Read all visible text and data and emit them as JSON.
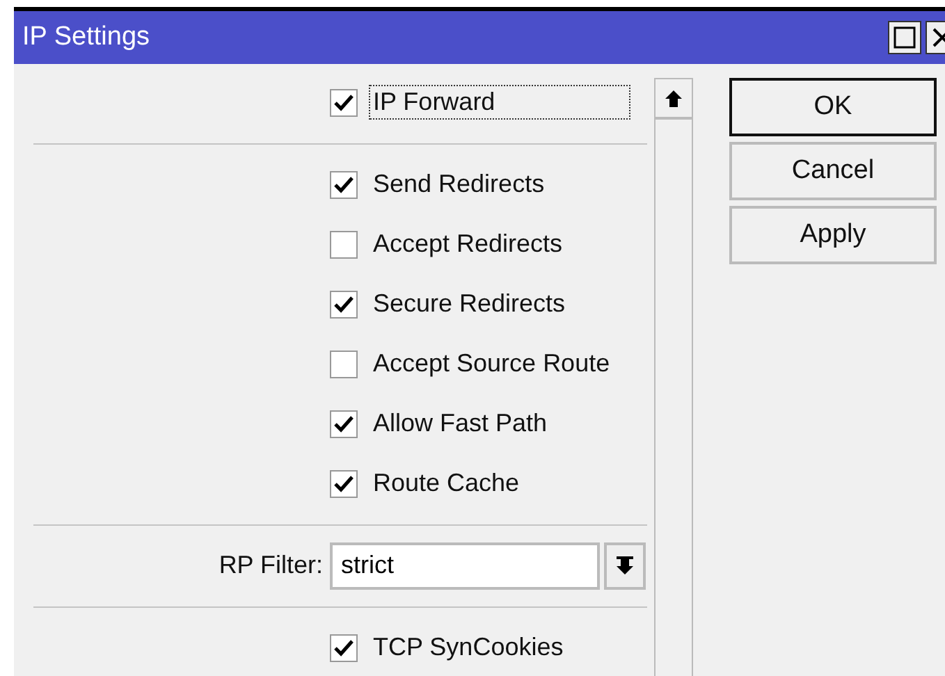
{
  "window": {
    "title": "IP Settings"
  },
  "sections": [
    {
      "fields": [
        {
          "kind": "checkbox",
          "label": "IP Forward",
          "checked": true,
          "focused": true
        }
      ]
    },
    {
      "fields": [
        {
          "kind": "checkbox",
          "label": "Send Redirects",
          "checked": true,
          "focused": false
        },
        {
          "kind": "checkbox",
          "label": "Accept Redirects",
          "checked": false,
          "focused": false
        },
        {
          "kind": "checkbox",
          "label": "Secure Redirects",
          "checked": true,
          "focused": false
        },
        {
          "kind": "checkbox",
          "label": "Accept Source Route",
          "checked": false,
          "focused": false
        },
        {
          "kind": "checkbox",
          "label": "Allow Fast Path",
          "checked": true,
          "focused": false
        },
        {
          "kind": "checkbox",
          "label": "Route Cache",
          "checked": true,
          "focused": false
        }
      ]
    },
    {
      "fields": [
        {
          "kind": "select",
          "label": "RP Filter:",
          "value": "strict"
        }
      ]
    },
    {
      "fields": [
        {
          "kind": "checkbox",
          "label": "TCP SynCookies",
          "checked": true,
          "focused": false
        }
      ]
    }
  ],
  "buttons": [
    {
      "label": "OK",
      "default": true
    },
    {
      "label": "Cancel",
      "default": false
    },
    {
      "label": "Apply",
      "default": false
    }
  ]
}
